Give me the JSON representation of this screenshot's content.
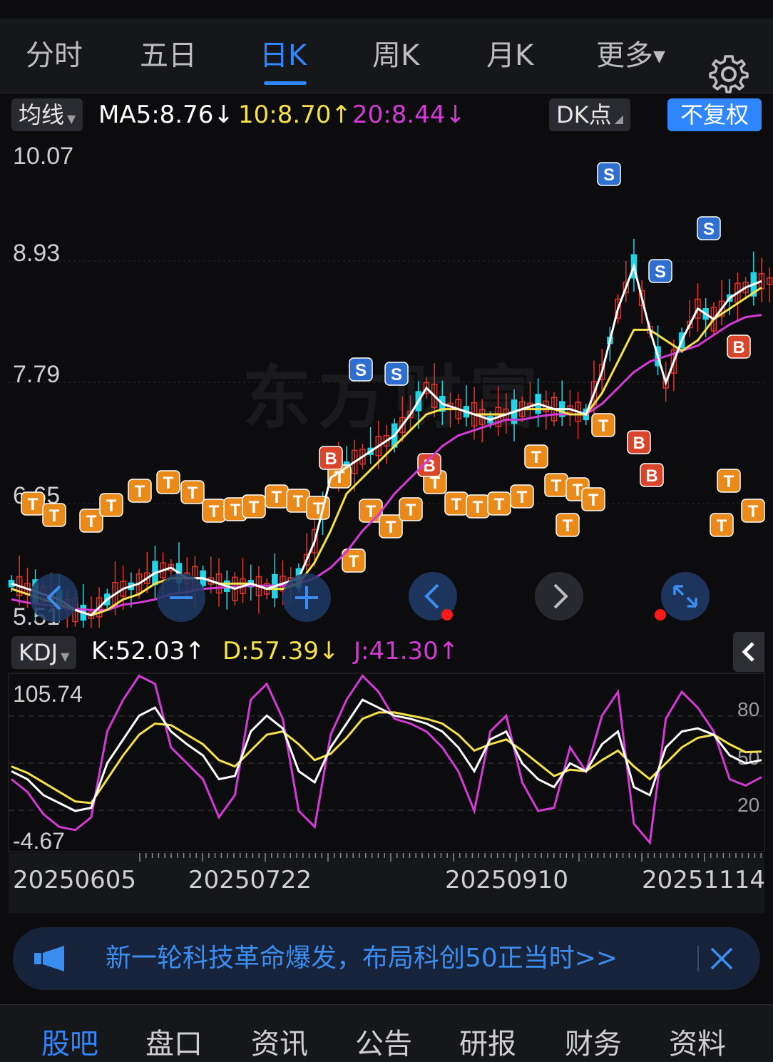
{
  "tabs": [
    "分时",
    "五日",
    "日K",
    "周K",
    "月K",
    "更多"
  ],
  "active_tab": "日K",
  "icons": {
    "settings": "gear-icon",
    "more_caret": "caret-down-icon",
    "collapse": "chevron-left-icon",
    "megaphone": "megaphone-icon",
    "close": "close-icon"
  },
  "indicator_select": "均线",
  "ma": {
    "ma5": "MA5:8.76↓",
    "ma10": "10:8.70↑",
    "ma20": "20:8.44↓"
  },
  "dk_point": "DK点",
  "fuquan": "不复权",
  "price_axis": [
    "10.07",
    "8.93",
    "7.79",
    "6.65",
    "5.51"
  ],
  "kdj": {
    "select": "KDJ",
    "k": "K:52.03↑",
    "d": "D:57.39↓",
    "j": "J:41.30↑",
    "axis_left": [
      "105.74",
      "-4.67"
    ],
    "axis_right": [
      "80",
      "50",
      "20"
    ]
  },
  "dates": [
    "20250605",
    "20250722",
    "20250910",
    "20251114"
  ],
  "banner": "新一轮科技革命爆发，布局科创50正当时>>",
  "bottom_nav": [
    "股吧",
    "盘口",
    "资讯",
    "公告",
    "研报",
    "财务",
    "资料"
  ],
  "active_nav": "股吧",
  "watermark": "东方财富",
  "colors": {
    "accent": "#2f86ff",
    "up": "#e0342b",
    "down": "#22d3e6",
    "ma5": "#ffffff",
    "ma10": "#f5e14a",
    "ma20": "#d43ad6"
  },
  "chart_data": {
    "type": "candlestick",
    "ylim": [
      5.51,
      10.07
    ],
    "price_ticks": [
      10.07,
      8.93,
      7.79,
      6.65,
      5.51
    ],
    "ma5": [
      5.9,
      5.85,
      5.8,
      5.75,
      5.65,
      5.6,
      5.75,
      5.85,
      5.9,
      6.0,
      6.05,
      5.95,
      5.95,
      5.9,
      5.85,
      5.9,
      5.85,
      5.9,
      5.95,
      6.3,
      6.9,
      7.0,
      7.1,
      7.2,
      7.3,
      7.5,
      7.75,
      7.6,
      7.55,
      7.5,
      7.45,
      7.5,
      7.55,
      7.6,
      7.55,
      7.55,
      7.5,
      7.9,
      8.5,
      8.9,
      8.3,
      7.8,
      8.2,
      8.5,
      8.4,
      8.6,
      8.7,
      8.76
    ],
    "ma10": [
      5.85,
      5.8,
      5.75,
      5.7,
      5.65,
      5.6,
      5.65,
      5.75,
      5.8,
      5.9,
      5.95,
      5.95,
      5.95,
      5.9,
      5.9,
      5.9,
      5.85,
      5.85,
      5.9,
      6.1,
      6.4,
      6.75,
      6.9,
      7.05,
      7.2,
      7.35,
      7.5,
      7.55,
      7.55,
      7.5,
      7.5,
      7.5,
      7.55,
      7.55,
      7.55,
      7.5,
      7.5,
      7.7,
      8.0,
      8.3,
      8.3,
      8.2,
      8.1,
      8.2,
      8.4,
      8.5,
      8.6,
      8.7
    ],
    "ma20": [
      5.75,
      5.72,
      5.7,
      5.68,
      5.66,
      5.65,
      5.65,
      5.7,
      5.72,
      5.75,
      5.8,
      5.82,
      5.85,
      5.86,
      5.87,
      5.88,
      5.88,
      5.88,
      5.9,
      5.95,
      6.05,
      6.2,
      6.4,
      6.55,
      6.75,
      6.9,
      7.05,
      7.2,
      7.3,
      7.35,
      7.4,
      7.45,
      7.45,
      7.48,
      7.5,
      7.5,
      7.5,
      7.6,
      7.75,
      7.9,
      8.0,
      8.05,
      8.1,
      8.15,
      8.25,
      8.35,
      8.42,
      8.44
    ],
    "kdj_ylim": [
      -4.67,
      105.74
    ],
    "K": [
      45,
      40,
      30,
      25,
      20,
      22,
      50,
      65,
      80,
      85,
      70,
      62,
      55,
      40,
      42,
      70,
      80,
      72,
      45,
      38,
      60,
      75,
      90,
      85,
      80,
      78,
      75,
      70,
      60,
      45,
      65,
      70,
      50,
      40,
      35,
      50,
      45,
      62,
      70,
      35,
      30,
      60,
      70,
      72,
      68,
      55,
      50,
      52.03
    ],
    "D": [
      48,
      44,
      38,
      32,
      26,
      25,
      40,
      55,
      68,
      75,
      74,
      68,
      62,
      52,
      48,
      58,
      68,
      70,
      62,
      52,
      56,
      66,
      78,
      82,
      82,
      80,
      78,
      75,
      68,
      58,
      62,
      65,
      58,
      50,
      42,
      46,
      45,
      52,
      58,
      48,
      40,
      50,
      60,
      66,
      68,
      62,
      57,
      57.39
    ],
    "J": [
      40,
      32,
      18,
      10,
      8,
      16,
      70,
      90,
      105,
      100,
      60,
      50,
      40,
      16,
      30,
      90,
      100,
      78,
      20,
      10,
      68,
      90,
      105,
      95,
      78,
      75,
      70,
      60,
      45,
      20,
      70,
      80,
      38,
      20,
      22,
      60,
      45,
      80,
      95,
      12,
      0,
      78,
      95,
      85,
      70,
      40,
      36,
      41.3
    ]
  }
}
